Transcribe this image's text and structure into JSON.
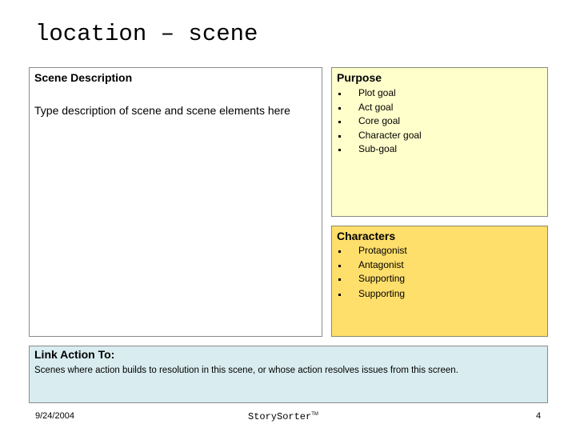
{
  "slide": {
    "title": "location – scene"
  },
  "scene_description": {
    "heading": "Scene Description",
    "body": "Type description of scene and scene elements here"
  },
  "purpose": {
    "heading": "Purpose",
    "items": [
      "Plot goal",
      "Act goal",
      "Core goal",
      "Character goal",
      "Sub-goal"
    ]
  },
  "characters": {
    "heading": "Characters",
    "items": [
      "Protagonist",
      "Antagonist",
      "Supporting",
      "Supporting"
    ]
  },
  "link_action": {
    "heading": "Link Action To:",
    "body": "Scenes where action builds to resolution in this scene, or whose action resolves issues from this screen."
  },
  "footer": {
    "date": "9/24/2004",
    "brand": "StorySorter",
    "trademark": "TM",
    "page_number": "4"
  },
  "colors": {
    "purpose_bg": "#ffffcc",
    "characters_bg": "#ffdf6b",
    "link_bg": "#d9ecef"
  }
}
